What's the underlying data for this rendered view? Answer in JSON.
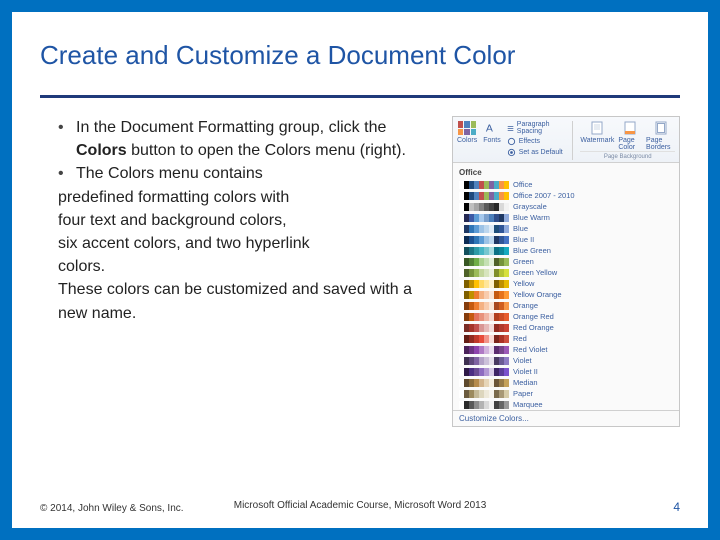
{
  "title": "Create and Customize a Document Color",
  "bullets": {
    "b1_pre": "In the Document Formatting group, click the ",
    "b1_bold": "Colors",
    "b1_post": " button to open the Colors menu (right).",
    "b2": "The Colors menu contains",
    "cont1": "predefined formatting colors with",
    "cont2": "four text and background colors,",
    "cont3": "six accent colors, and two hyperlink",
    "cont4": "colors.",
    "cont5": "These colors can be customized and saved with a new name."
  },
  "ribbon": {
    "colors": "Colors",
    "fonts": "Fonts",
    "paragraph_spacing": "Paragraph Spacing",
    "effects": "Effects",
    "set_default": "Set as Default",
    "watermark": "Watermark",
    "page_color": "Page Color",
    "page_borders": "Page Borders",
    "group_label": "Page Background"
  },
  "colors_menu": {
    "header": "Office",
    "themes": [
      "Office",
      "Office 2007 - 2010",
      "Grayscale",
      "Blue Warm",
      "Blue",
      "Blue II",
      "Blue Green",
      "Green",
      "Green Yellow",
      "Yellow",
      "Yellow Orange",
      "Orange",
      "Orange Red",
      "Red Orange",
      "Red",
      "Red Violet",
      "Violet",
      "Violet II",
      "Median",
      "Paper",
      "Marquee"
    ],
    "customize": "Customize Colors..."
  },
  "theme_palettes": [
    [
      "#ffffff",
      "#000000",
      "#1f497d",
      "#4f81bd",
      "#c0504d",
      "#9bbb59",
      "#8064a2",
      "#4bacc6",
      "#f79646",
      "#ffc000"
    ],
    [
      "#ffffff",
      "#000000",
      "#1f497d",
      "#4f81bd",
      "#c0504d",
      "#9bbb59",
      "#8064a2",
      "#4bacc6",
      "#f79646",
      "#ffc000"
    ],
    [
      "#ffffff",
      "#000000",
      "#bfbfbf",
      "#a6a6a6",
      "#808080",
      "#595959",
      "#404040",
      "#262626",
      "#d9d9d9",
      "#f2f2f2"
    ],
    [
      "#ffffff",
      "#242852",
      "#3c5aa6",
      "#5b9bd5",
      "#a5c8ed",
      "#7ba0cd",
      "#4a7ebb",
      "#2e4d8a",
      "#1f3864",
      "#8faadc"
    ],
    [
      "#ffffff",
      "#1f3864",
      "#2e75b6",
      "#5b9bd5",
      "#9dc3e6",
      "#bdd7ee",
      "#deebf7",
      "#1f4e79",
      "#2f5597",
      "#8faadc"
    ],
    [
      "#ffffff",
      "#0d2c54",
      "#1b5091",
      "#2e75b6",
      "#5b9bd5",
      "#9dc3e6",
      "#bdd7ee",
      "#203864",
      "#2f5597",
      "#4472c4"
    ],
    [
      "#ffffff",
      "#134f5c",
      "#1c7685",
      "#2e9ba6",
      "#45b5c4",
      "#76c7d0",
      "#a9dde1",
      "#0b7285",
      "#0c8599",
      "#15aabf"
    ],
    [
      "#ffffff",
      "#385723",
      "#538135",
      "#70ad47",
      "#a9d18e",
      "#c5e0b4",
      "#e2f0d9",
      "#4f6228",
      "#76933c",
      "#9bbb59"
    ],
    [
      "#ffffff",
      "#4f6228",
      "#76933c",
      "#9bbb59",
      "#c3d69b",
      "#d7e4bd",
      "#ebf1dd",
      "#7f8f29",
      "#b5c535",
      "#d6e03d"
    ],
    [
      "#ffffff",
      "#7f6000",
      "#bf9000",
      "#ffc000",
      "#ffd966",
      "#ffe699",
      "#fff2cc",
      "#806000",
      "#bf8f00",
      "#e6b800"
    ],
    [
      "#ffffff",
      "#806000",
      "#bf8f00",
      "#ed7d31",
      "#f4b183",
      "#f8cbad",
      "#fbe5d6",
      "#c55a11",
      "#e6731b",
      "#ff9933"
    ],
    [
      "#ffffff",
      "#843c0c",
      "#c55a11",
      "#ed7d31",
      "#f4b183",
      "#f8cbad",
      "#fbe5d6",
      "#a8471e",
      "#d05d1e",
      "#f79646"
    ],
    [
      "#ffffff",
      "#843c0c",
      "#c55a11",
      "#e2725b",
      "#e8927c",
      "#f0b5a4",
      "#f7d8cf",
      "#b23e1e",
      "#cc4b24",
      "#e65c2e"
    ],
    [
      "#ffffff",
      "#7b2d26",
      "#a5352b",
      "#c0504d",
      "#d99694",
      "#e6b9b8",
      "#f2dcdb",
      "#922b21",
      "#b03a2e",
      "#cb4335"
    ],
    [
      "#ffffff",
      "#641e16",
      "#922b21",
      "#c0392b",
      "#e74c3c",
      "#f1948a",
      "#fadbd8",
      "#7b241c",
      "#a93226",
      "#cd4f3e"
    ],
    [
      "#ffffff",
      "#4a235a",
      "#6c3483",
      "#8e44ad",
      "#af7ac5",
      "#d2b4de",
      "#ebdef0",
      "#5b2c6f",
      "#76448a",
      "#9b59b6"
    ],
    [
      "#ffffff",
      "#3f3151",
      "#604a7b",
      "#8064a2",
      "#b3a2c7",
      "#ccc1da",
      "#e6e0ec",
      "#4a3b63",
      "#6b5b95",
      "#8e7cc3"
    ],
    [
      "#ffffff",
      "#2e1a47",
      "#4b2e83",
      "#6a4c93",
      "#8e6cc0",
      "#b399d4",
      "#d9cce9",
      "#3d2466",
      "#5c3d99",
      "#7b52cc"
    ],
    [
      "#ffffff",
      "#5e4a2e",
      "#8a6d3b",
      "#b58b4c",
      "#d2b48c",
      "#e6d5b8",
      "#f5eee0",
      "#6b5537",
      "#977b49",
      "#c4a15a"
    ],
    [
      "#ffffff",
      "#6b5b3e",
      "#9c8a5e",
      "#c4b998",
      "#ddd6bd",
      "#eee9da",
      "#f7f4ec",
      "#7a6a4a",
      "#a89875",
      "#d6cba8"
    ],
    [
      "#ffffff",
      "#2a2a2a",
      "#595959",
      "#8c8c8c",
      "#b3b3b3",
      "#d9d9d9",
      "#f2f2f2",
      "#404040",
      "#666666",
      "#999999"
    ]
  ],
  "footer": {
    "copyright": "© 2014, John Wiley & Sons, Inc.",
    "center": "Microsoft Official Academic Course, Microsoft Word 2013",
    "page": "4"
  }
}
